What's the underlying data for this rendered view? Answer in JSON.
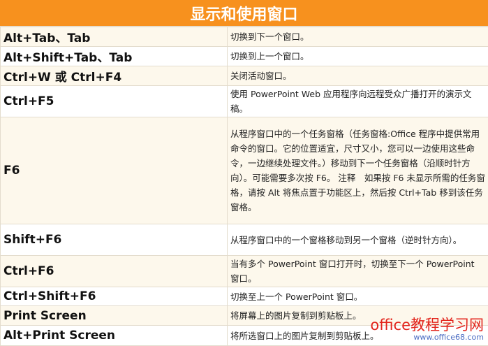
{
  "title": "显示和使用窗口",
  "rows": [
    {
      "key": "Alt+Tab、Tab",
      "desc": "切换到下一个窗口。"
    },
    {
      "key": "Alt+Shift+Tab、Tab",
      "desc": "切换到上一个窗口。"
    },
    {
      "key": "Ctrl+W 或 Ctrl+F4",
      "desc": "关闭活动窗口。"
    },
    {
      "key": "Ctrl+F5",
      "desc": "使用 PowerPoint Web 应用程序向远程受众广播打开的演示文稿。"
    },
    {
      "key": "F6",
      "desc": "从程序窗口中的一个任务窗格（任务窗格:Office 程序中提供常用命令的窗口。它的位置适宜，尺寸又小，您可以一边使用这些命令，一边继续处理文件。）移动到下一个任务窗格（沿顺时针方向）。可能需要多次按 F6。 注释　如果按 F6 未显示所需的任务窗格，请按 Alt 将焦点置于功能区上，然后按 Ctrl+Tab 移到该任务窗格。"
    },
    {
      "key": "Shift+F6",
      "desc": "从程序窗口中的一个窗格移动到另一个窗格（逆时针方向）。"
    },
    {
      "key": "Ctrl+F6",
      "desc": "当有多个 PowerPoint 窗口打开时，切换至下一个 PowerPoint 窗口。"
    },
    {
      "key": "Ctrl+Shift+F6",
      "desc": "切换至上一个 PowerPoint 窗口。"
    },
    {
      "key": "Print Screen",
      "desc": "将屏幕上的图片复制到剪贴板上。"
    },
    {
      "key": "Alt+Print Screen",
      "desc": "将所选窗口上的图片复制到剪贴板上。"
    }
  ],
  "watermark": {
    "main": "office教程学习网",
    "url": "www.office68.com"
  }
}
